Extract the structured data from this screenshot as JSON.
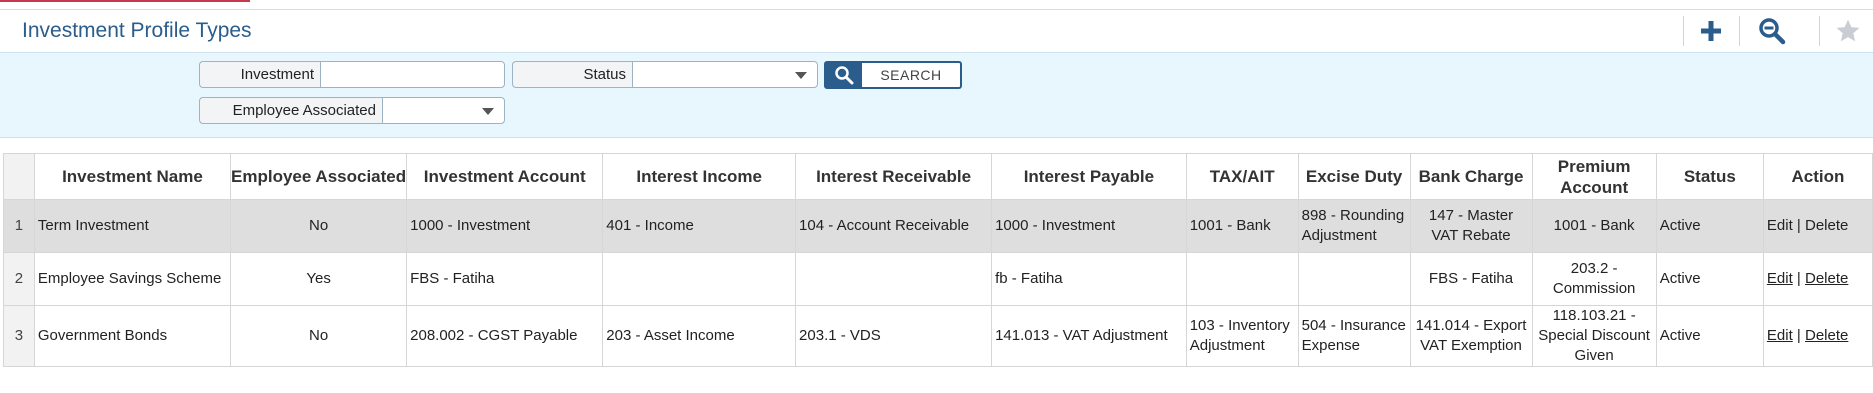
{
  "page": {
    "title": "Investment Profile Types"
  },
  "toolbar": {
    "add_icon": "plus-icon",
    "zoom_icon": "zoom-out-icon",
    "favorite_icon": "star-icon"
  },
  "filters": {
    "investment_label": "Investment",
    "investment_value": "",
    "status_label": "Status",
    "status_value": "",
    "employee_associated_label": "Employee Associated",
    "employee_associated_value": "",
    "search_label": "SEARCH"
  },
  "table": {
    "columns": [
      "",
      "Investment Name",
      "Employee Associated",
      "Investment Account",
      "Interest Income",
      "Interest Receivable",
      "Interest Payable",
      "TAX/AIT",
      "Excise Duty",
      "Bank Charge",
      "Premium Account",
      "Status",
      "Action"
    ],
    "rows": [
      {
        "n": "1",
        "name": "Term Investment",
        "emp": "No",
        "inv_acc": "1000 - Investment",
        "int_inc": "401 - Income",
        "int_rec": "104 - Account Receivable",
        "int_pay": "1000 - Investment",
        "tax": "1001 - Bank",
        "excise": "898 - Rounding Adjustment",
        "bank": "147 - Master VAT Rebate",
        "premium": "1001 - Bank",
        "status": "Active",
        "edit": "Edit",
        "sep": "|",
        "del": "Delete"
      },
      {
        "n": "2",
        "name": "Employee Savings Scheme",
        "emp": "Yes",
        "inv_acc": "FBS - Fatiha",
        "int_inc": "",
        "int_rec": "",
        "int_pay": "fb - Fatiha",
        "tax": "",
        "excise": "",
        "bank": "FBS - Fatiha",
        "premium": "203.2 - Commission",
        "status": "Active",
        "edit": "Edit",
        "sep": "|",
        "del": "Delete"
      },
      {
        "n": "3",
        "name": "Government Bonds",
        "emp": "No",
        "inv_acc": "208.002 - CGST Payable",
        "int_inc": "203 - Asset Income",
        "int_rec": "203.1 - VDS",
        "int_pay": "141.013 - VAT Adjustment",
        "tax": "103 - Inventory Adjustment",
        "excise": "504 - Insurance Expense",
        "bank": "141.014 - Export VAT Exemption",
        "premium": "118.103.21 - Special Discount Given",
        "status": "Active",
        "edit": "Edit",
        "sep": "|",
        "del": "Delete"
      }
    ]
  },
  "colors": {
    "title": "#2a5d8c",
    "filter_bg": "#e8f6fd",
    "row_highlight": "#dedede"
  }
}
